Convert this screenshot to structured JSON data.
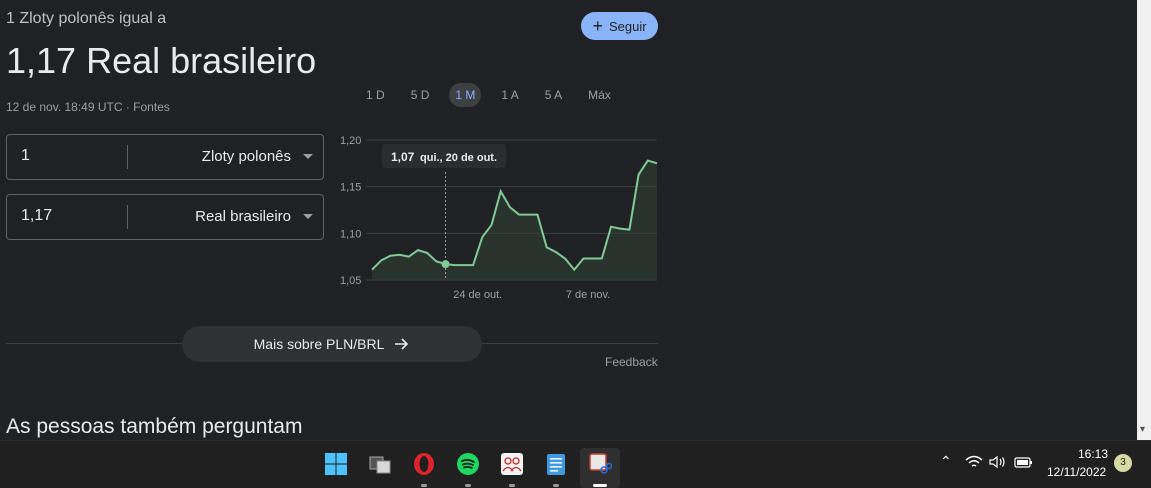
{
  "header": {
    "subtitle": "1 Zloty polonês igual a",
    "value_line": "1,17 Real brasileiro",
    "timestamp": "12 de nov. 18:49 UTC · Fontes"
  },
  "follow_button": {
    "label": "Seguir"
  },
  "converter": {
    "from": {
      "amount": "1",
      "currency": "Zloty polonês"
    },
    "to": {
      "amount": "1,17",
      "currency": "Real brasileiro"
    }
  },
  "range_tabs": [
    "1 D",
    "5 D",
    "1 M",
    "1 A",
    "5 A",
    "Máx"
  ],
  "active_range": "1 M",
  "tooltip": {
    "value": "1,07",
    "date": "qui., 20 de out."
  },
  "chart_data": {
    "type": "area",
    "y_ticks": [
      "1,20",
      "1,15",
      "1,10",
      "1,05"
    ],
    "y_tick_values": [
      1.2,
      1.15,
      1.1,
      1.05
    ],
    "x_ticks": [
      "24 de out.",
      "7 de nov."
    ],
    "x_tick_positions": [
      11.5,
      23.5
    ],
    "ylim": [
      1.05,
      1.2
    ],
    "values": [
      1.061,
      1.071,
      1.076,
      1.077,
      1.075,
      1.082,
      1.079,
      1.07,
      1.067,
      1.066,
      1.066,
      1.066,
      1.096,
      1.109,
      1.145,
      1.128,
      1.12,
      1.12,
      1.12,
      1.085,
      1.08,
      1.073,
      1.061,
      1.073,
      1.073,
      1.073,
      1.107,
      1.105,
      1.104,
      1.163,
      1.178,
      1.175
    ],
    "highlight_index": 8,
    "line_color": "#81c995",
    "fill_color": "#2f4434",
    "grid": true
  },
  "more_button": {
    "label": "Mais sobre PLN/BRL"
  },
  "feedback": "Feedback",
  "people_also_ask": "As pessoas também perguntam",
  "taskbar": {
    "apps": [
      "windows-start",
      "task-view",
      "opera",
      "spotify",
      "teams",
      "notepad",
      "snipping-tool"
    ],
    "time": "16:13",
    "date": "12/11/2022",
    "notifications": "3"
  }
}
